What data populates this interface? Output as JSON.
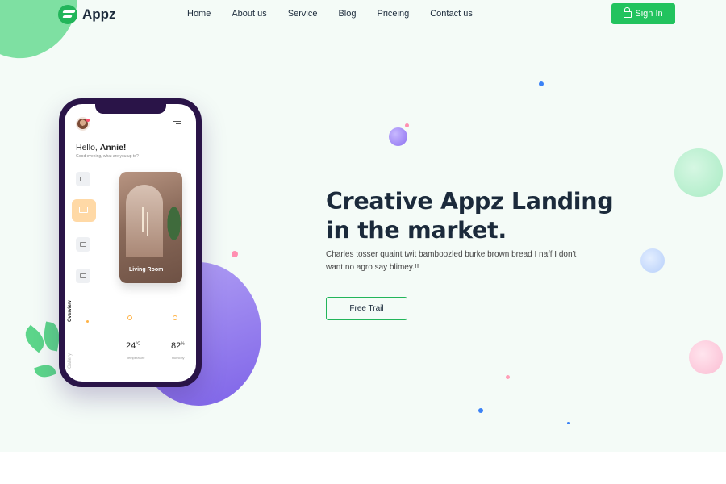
{
  "header": {
    "logo_text": "Appz",
    "nav": [
      "Home",
      "About us",
      "Service",
      "Blog",
      "Priceing",
      "Contact us"
    ],
    "signin_label": "Sign In"
  },
  "phone": {
    "greeting_prefix": "Hello, ",
    "greeting_name": "Annie!",
    "greeting_sub": "Good evening, what are you up to?",
    "room_label": "Living Room",
    "tab_overview": "Overview",
    "tab_gallery": "Gallery",
    "temperature_value": "24",
    "temperature_unit": "°C",
    "temperature_label": "Temperature",
    "humidity_value": "82",
    "humidity_unit": "%",
    "humidity_label": "Humidity"
  },
  "hero": {
    "headline_line1": "Creative Appz Landing",
    "headline_line2": "in the market.",
    "description": "Charles tosser quaint twit bamboozled burke brown bread I naff I don't want no agro say blimey.!!",
    "cta_label": "Free Trail"
  },
  "colors": {
    "brand_green": "#22c35e",
    "heading": "#1b2a3b",
    "phone_frame": "#2a1448",
    "disk_purple": "#8f78ee",
    "background": "#f4fbf7"
  },
  "icons": [
    "logo-icon",
    "lock-icon",
    "menu-icon",
    "avatar",
    "mail-icon",
    "image-icon",
    "bed-icon",
    "home-icon",
    "sun-icon",
    "droplet-icon"
  ]
}
